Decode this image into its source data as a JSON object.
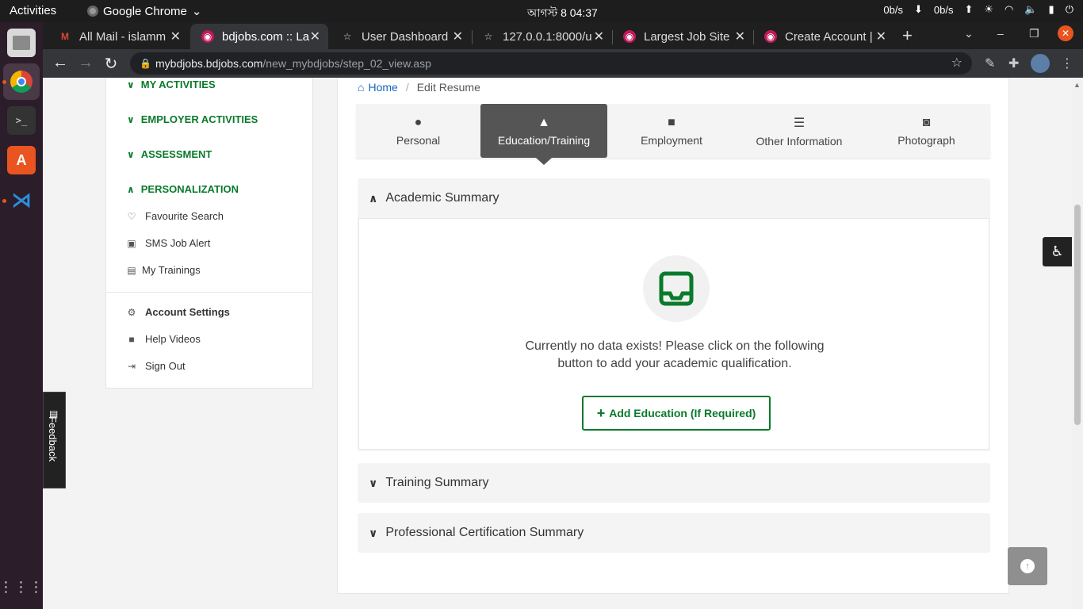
{
  "system": {
    "activities": "Activities",
    "app_name": "Google Chrome",
    "clock": "আগস্ট 8  04:37",
    "net_down": "0b/s",
    "net_up": "0b/s"
  },
  "browser": {
    "tabs": [
      {
        "title": "All Mail - islamm",
        "icon": "gmail-icon"
      },
      {
        "title": "bdjobs.com :: La",
        "icon": "bdjobs-icon"
      },
      {
        "title": "User Dashboard",
        "icon": "star-icon"
      },
      {
        "title": "127.0.0.1:8000/u",
        "icon": "star-icon"
      },
      {
        "title": "Largest Job Site",
        "icon": "bdjobs-icon"
      },
      {
        "title": "Create Account |",
        "icon": "bdjobs-icon"
      }
    ],
    "url_domain": "mybdjobs.bdjobs.com",
    "url_path": "/new_mybdjobs/step_02_view.asp"
  },
  "sidebar": {
    "sections": [
      {
        "label": "MY ACTIVITIES",
        "expanded": false
      },
      {
        "label": "EMPLOYER ACTIVITIES",
        "expanded": false
      },
      {
        "label": "ASSESSMENT",
        "expanded": false
      },
      {
        "label": "PERSONALIZATION",
        "expanded": true
      }
    ],
    "personalization_items": [
      {
        "label": "Favourite Search",
        "icon": "heart-icon"
      },
      {
        "label": "SMS Job Alert",
        "icon": "sms-icon"
      },
      {
        "label": "My Trainings",
        "icon": "training-icon"
      }
    ],
    "bottom_items": [
      {
        "label": "Account Settings",
        "icon": "gear-icon"
      },
      {
        "label": "Help Videos",
        "icon": "video-icon"
      },
      {
        "label": "Sign Out",
        "icon": "sign-out-icon"
      }
    ]
  },
  "feedback": {
    "label": "Feedback"
  },
  "breadcrumb": {
    "home": "Home",
    "current": "Edit Resume"
  },
  "resume_tabs": [
    {
      "label": "Personal",
      "icon": "person-icon",
      "active": false
    },
    {
      "label": "Education/Training",
      "icon": "graduation-cap-icon",
      "active": true
    },
    {
      "label": "Employment",
      "icon": "briefcase-icon",
      "active": false
    },
    {
      "label": "Other Information",
      "icon": "list-icon",
      "active": false
    },
    {
      "label": "Photograph",
      "icon": "camera-icon",
      "active": false
    }
  ],
  "panels": {
    "academic": {
      "title": "Academic Summary",
      "empty_line1": "Currently no data exists! Please click on the following",
      "empty_line2": "button to add your academic qualification.",
      "add_button": "Add Education (If Required)"
    },
    "training": {
      "title": "Training Summary"
    },
    "certification": {
      "title": "Professional Certification Summary"
    }
  },
  "colors": {
    "accent_green": "#0a7a2b",
    "link_blue": "#1565c0",
    "active_tab": "#555555"
  }
}
